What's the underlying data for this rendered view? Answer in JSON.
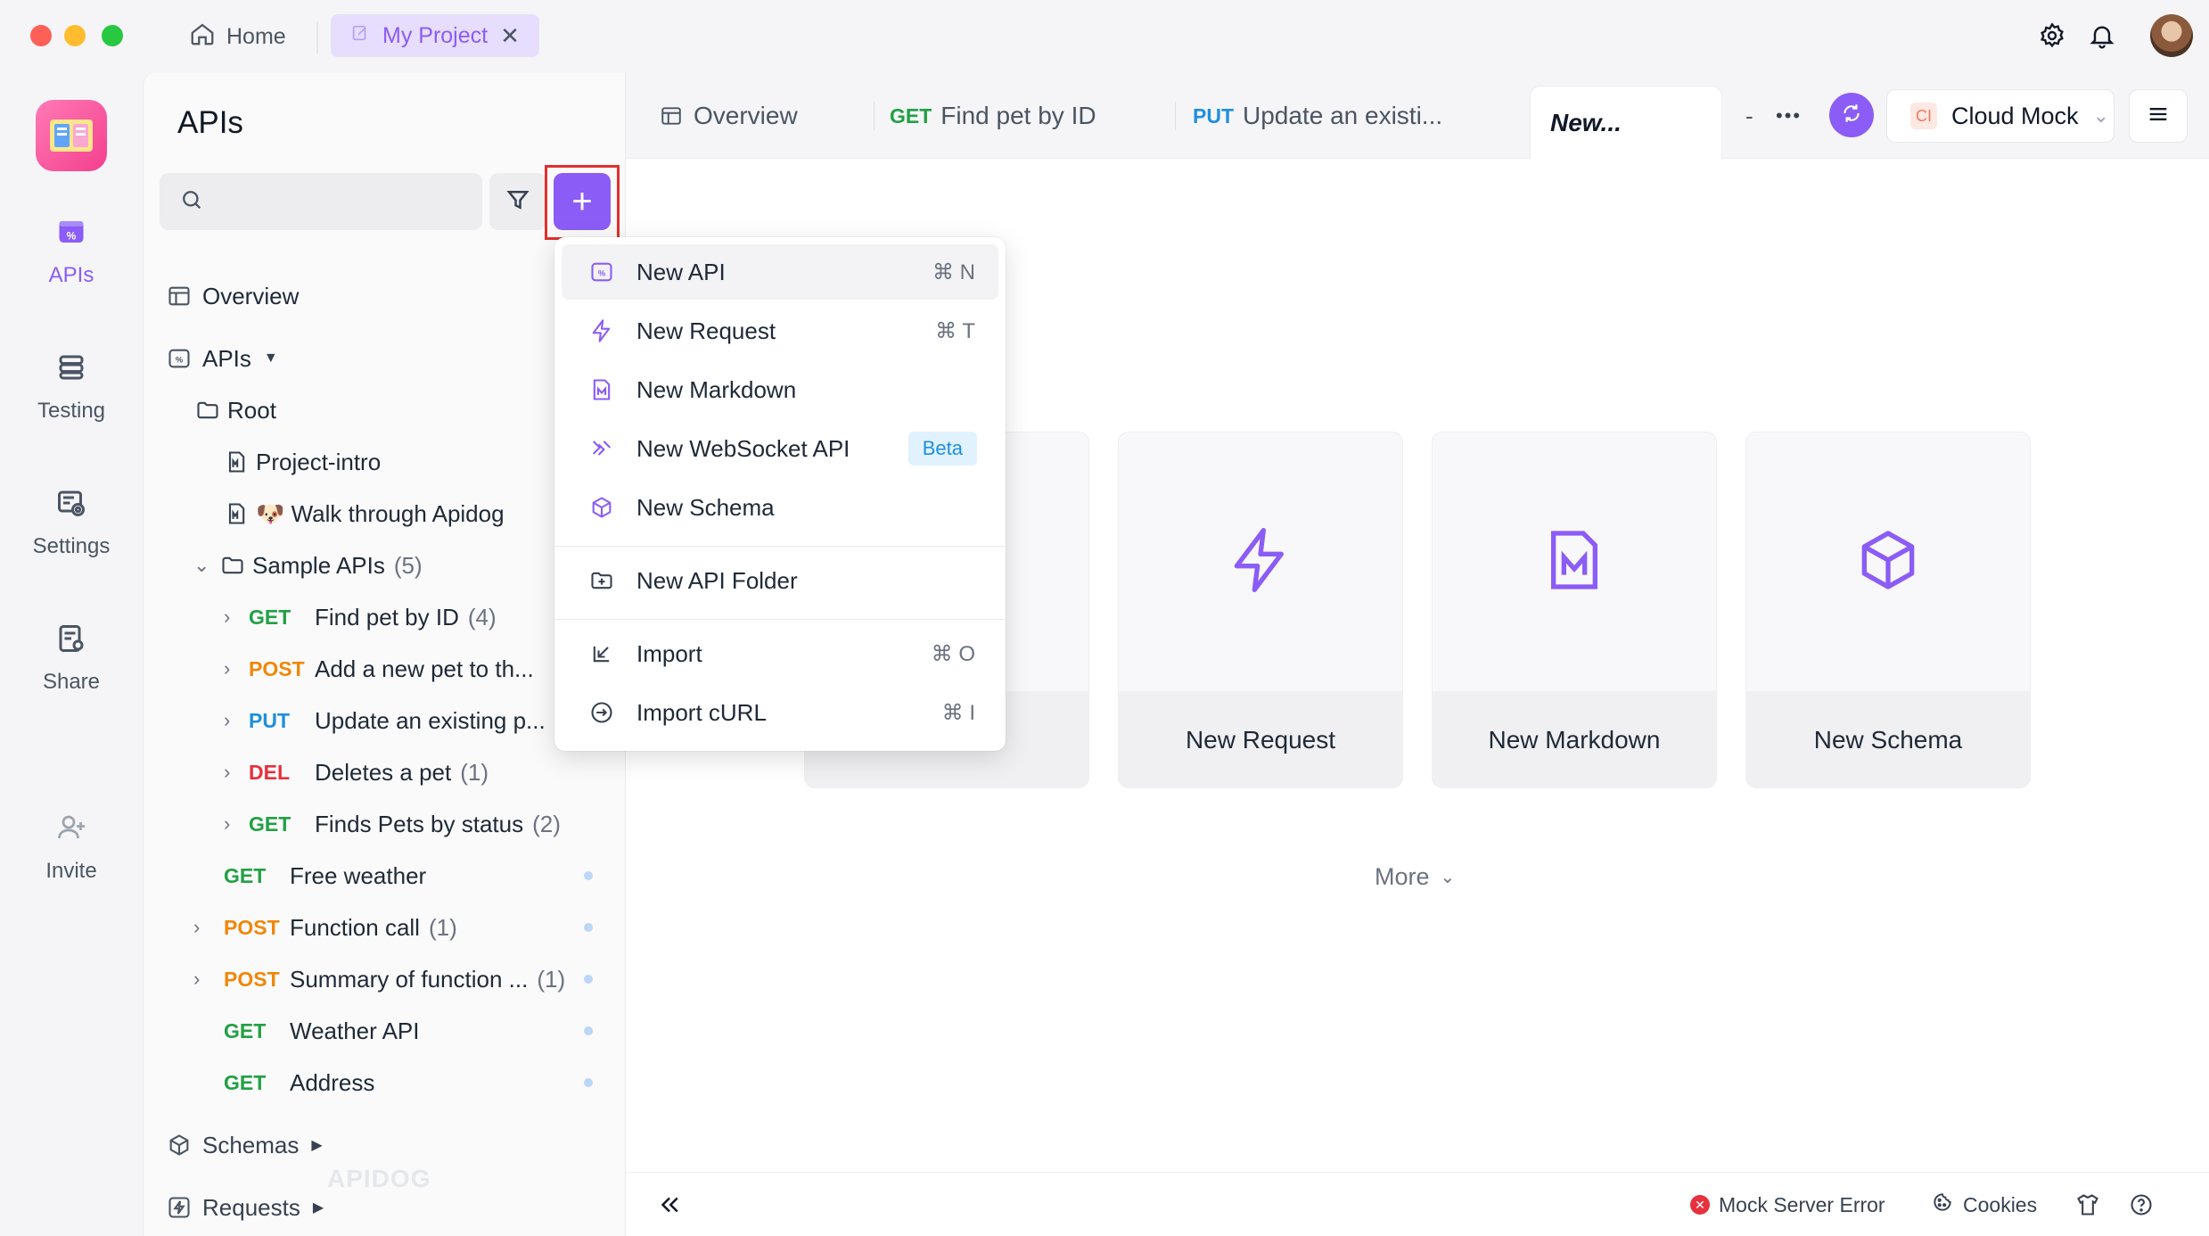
{
  "titlebar": {
    "home_label": "Home",
    "project_tab_label": "My Project",
    "project_tab_close": "✕"
  },
  "rail": {
    "items": [
      {
        "label": "APIs"
      },
      {
        "label": "Testing"
      },
      {
        "label": "Settings"
      },
      {
        "label": "Share"
      },
      {
        "label": "Invite"
      }
    ]
  },
  "sidebar": {
    "title": "APIs",
    "search_placeholder": "",
    "add_label": "+",
    "overview": "Overview",
    "apis_label": "APIs",
    "root": "Root",
    "project_intro": "Project-intro",
    "walk_through": "🐶 Walk through Apidog",
    "sample_apis": {
      "label": "Sample APIs",
      "count": "(5)"
    },
    "sample_children": [
      {
        "method": "GET",
        "name": "Find pet by ID",
        "count": "(4)"
      },
      {
        "method": "POST",
        "name": "Add a new pet to th...",
        "count": ""
      },
      {
        "method": "PUT",
        "name": "Update an existing p...",
        "count": ""
      },
      {
        "method": "DEL",
        "name": "Deletes a pet",
        "count": "(1)"
      },
      {
        "method": "GET",
        "name": "Finds Pets by status",
        "count": "(2)"
      }
    ],
    "top_endpoints": [
      {
        "method": "GET",
        "name": "Free weather",
        "count": ""
      },
      {
        "method": "POST",
        "name": "Function call",
        "count": "(1)"
      },
      {
        "method": "POST",
        "name": "Summary of function ...",
        "count": "(1)"
      },
      {
        "method": "GET",
        "name": "Weather API",
        "count": ""
      },
      {
        "method": "GET",
        "name": "Address",
        "count": ""
      }
    ],
    "schemas": "Schemas",
    "requests": "Requests",
    "watermark": "APIDOG"
  },
  "tabs": [
    {
      "method": "",
      "label": "Overview"
    },
    {
      "method": "GET",
      "label": "Find pet by ID"
    },
    {
      "method": "PUT",
      "label": "Update an existi..."
    },
    {
      "method": "",
      "label": "New..."
    }
  ],
  "tabbar_extras": {
    "dash": "-",
    "more": "•••"
  },
  "env": {
    "badge": "CI",
    "name": "Cloud Mock"
  },
  "dropdown": {
    "items": [
      {
        "label": "New API",
        "shortcut": "⌘ N"
      },
      {
        "label": "New Request",
        "shortcut": "⌘ T"
      },
      {
        "label": "New Markdown",
        "shortcut": ""
      },
      {
        "label": "New WebSocket API",
        "badge": "Beta"
      },
      {
        "label": "New Schema",
        "shortcut": ""
      },
      {
        "label": "New API Folder",
        "shortcut": ""
      },
      {
        "label": "Import",
        "shortcut": "⌘ O"
      },
      {
        "label": "Import cURL",
        "shortcut": "⌘ I"
      }
    ]
  },
  "cards": [
    {
      "label": "New Request"
    },
    {
      "label": "New Markdown"
    },
    {
      "label": "New Schema"
    }
  ],
  "more_label": "More",
  "statusbar": {
    "mock_error": "Mock Server Error",
    "cookies": "Cookies"
  },
  "colors": {
    "accent": "#8b5cf6",
    "get": "#22a045",
    "post": "#f0870a",
    "put": "#1e8fe0",
    "del": "#e5323e",
    "highlight_box": "#e0302f"
  }
}
